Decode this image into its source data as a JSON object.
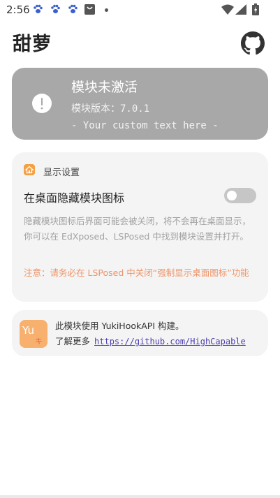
{
  "status_bar": {
    "time": "2:56",
    "notification_icons": [
      "paw-icon",
      "paw-icon",
      "paw-icon",
      "shopping-bag-icon"
    ],
    "system_icons": [
      "wifi-icon",
      "signal-icon",
      "battery-icon"
    ]
  },
  "header": {
    "title": "甜萝",
    "github_icon": "github-icon"
  },
  "module_status": {
    "title": "模块未激活",
    "version": "模块版本：7.0.1",
    "custom_text": "- Your custom text here -",
    "icon": "exclamation-circle-icon"
  },
  "display_settings": {
    "section_title": "显示设置",
    "section_icon": "home-icon",
    "hide_icon_label": "在桌面隐藏模块图标",
    "hide_icon_enabled": false,
    "description": "隐藏模块图标后界面可能会被关闭，将不会再在桌面显示，你可以在 EdXposed、LSPosed 中找到模块设置并打开。",
    "warning": "注意：请务必在 LSPosed 中关闭“强制显示桌面图标”功能"
  },
  "about": {
    "line1": "此模块使用 YukiHookAPI 构建。",
    "line2_prefix": "了解更多",
    "link": "https://github.com/HighCapable",
    "logo_text": "Yu",
    "logo_sub": "キ"
  },
  "colors": {
    "status_card_bg": "#a8a8a8",
    "card_bg": "#f4f4f4",
    "accent_orange": "#f5a043",
    "warning_text": "#ee9468",
    "link": "#4a3fb0"
  }
}
